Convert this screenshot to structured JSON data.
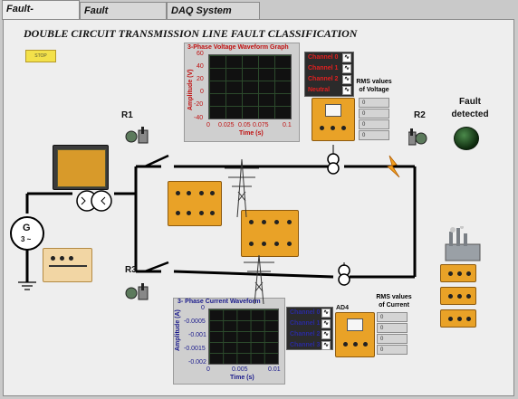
{
  "tabs": [
    {
      "label": "Fault-Protection",
      "active": true
    },
    {
      "label": "Fault Classification",
      "active": false
    },
    {
      "label": "DAQ System Config",
      "active": false
    }
  ],
  "title": "DOUBLE CIRCUIT TRANSMISSION LINE FAULT CLASSIFICATION",
  "stop_button": "STOP",
  "voltage_graph": {
    "title": "3-Phase Voltage Waveform Graph",
    "ylabel": "Amplitude (V)",
    "xlabel": "Time (s)",
    "yticks": [
      "60",
      "40",
      "20",
      "0",
      "-20",
      "-40"
    ],
    "xticks": [
      "0",
      "0.025",
      "0.05",
      "0.075",
      "0.1"
    ],
    "legend": [
      "Channel 0",
      "Channel 1",
      "Channel 2",
      "Neutral"
    ],
    "color": "#d01010"
  },
  "voltage_rms": {
    "label": "RMS values of Voltage",
    "values": [
      "0",
      "0",
      "0",
      "0"
    ]
  },
  "current_graph": {
    "title": "3- Phase Current Waveform",
    "ylabel": "Amplitude (A)",
    "xlabel": "Time (s)",
    "yticks": [
      "0",
      "-0.0005",
      "-0.001",
      "-0.0015",
      "-0.002"
    ],
    "xticks": [
      "0",
      "0.005",
      "0.01"
    ],
    "legend": [
      "Channel 0",
      "Channel 1",
      "Channel 2",
      "Channel 3"
    ],
    "color": "#1a1a8c"
  },
  "current_rms": {
    "label": "RMS values of Current",
    "values": [
      "0",
      "0",
      "0",
      "0"
    ]
  },
  "labels": {
    "r1": "R1",
    "r2": "R2",
    "r3": "R3",
    "fault": "Fault detected",
    "ad4": "AD4",
    "generator": "G",
    "generator_sub": "3 ~"
  }
}
